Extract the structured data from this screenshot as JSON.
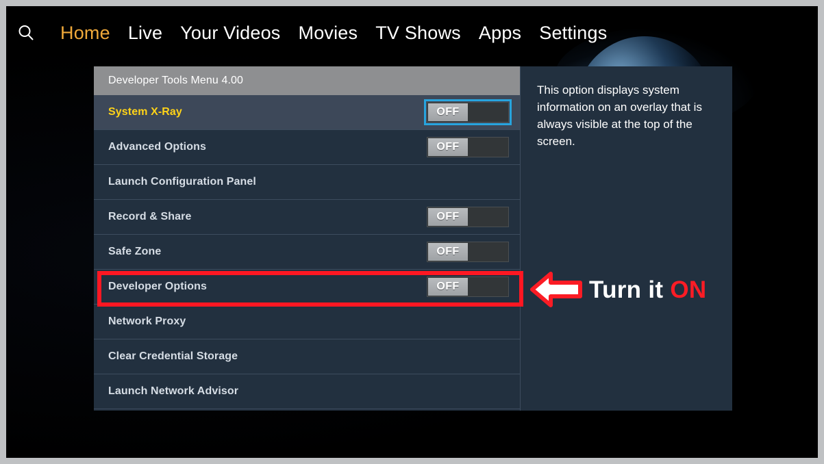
{
  "topnav": {
    "search_icon": "search-icon",
    "bell_icon": "bell-notification-icon",
    "items": [
      {
        "label": "Home",
        "active": true
      },
      {
        "label": "Live",
        "active": false
      },
      {
        "label": "Your Videos",
        "active": false
      },
      {
        "label": "Movies",
        "active": false
      },
      {
        "label": "TV Shows",
        "active": false
      },
      {
        "label": "Apps",
        "active": false
      },
      {
        "label": "Settings",
        "active": false
      }
    ]
  },
  "menu": {
    "header": "Developer Tools Menu 4.00",
    "rows": [
      {
        "label": "System X-Ray",
        "toggle": "OFF",
        "has_toggle": true,
        "selected": true,
        "focused": true
      },
      {
        "label": "Advanced Options",
        "toggle": "OFF",
        "has_toggle": true,
        "selected": false,
        "focused": false
      },
      {
        "label": "Launch Configuration Panel",
        "toggle": "",
        "has_toggle": false,
        "selected": false,
        "focused": false
      },
      {
        "label": "Record & Share",
        "toggle": "OFF",
        "has_toggle": true,
        "selected": false,
        "focused": false
      },
      {
        "label": "Safe Zone",
        "toggle": "OFF",
        "has_toggle": true,
        "selected": false,
        "focused": false
      },
      {
        "label": "Developer Options",
        "toggle": "OFF",
        "has_toggle": true,
        "selected": false,
        "focused": false
      },
      {
        "label": "Network Proxy",
        "toggle": "",
        "has_toggle": false,
        "selected": false,
        "focused": false
      },
      {
        "label": "Clear Credential Storage",
        "toggle": "",
        "has_toggle": false,
        "selected": false,
        "focused": false
      },
      {
        "label": "Launch Network Advisor",
        "toggle": "",
        "has_toggle": false,
        "selected": false,
        "focused": false
      }
    ]
  },
  "description": {
    "text": "This option displays system information on an overlay that is always visible at the top of the screen."
  },
  "annotation": {
    "arrow_icon": "left-arrow-icon",
    "text_white": "Turn it",
    "text_red": "ON",
    "highlight_target": "Developer Options"
  },
  "colors": {
    "accent_orange": "#f0a93a",
    "selected_label_yellow": "#ffd318",
    "focus_blue": "#27a4de",
    "annotation_red": "#ff1722",
    "panel_bg": "#22303f",
    "header_bg": "#8e8f91",
    "selected_row_bg": "#3d4859"
  }
}
